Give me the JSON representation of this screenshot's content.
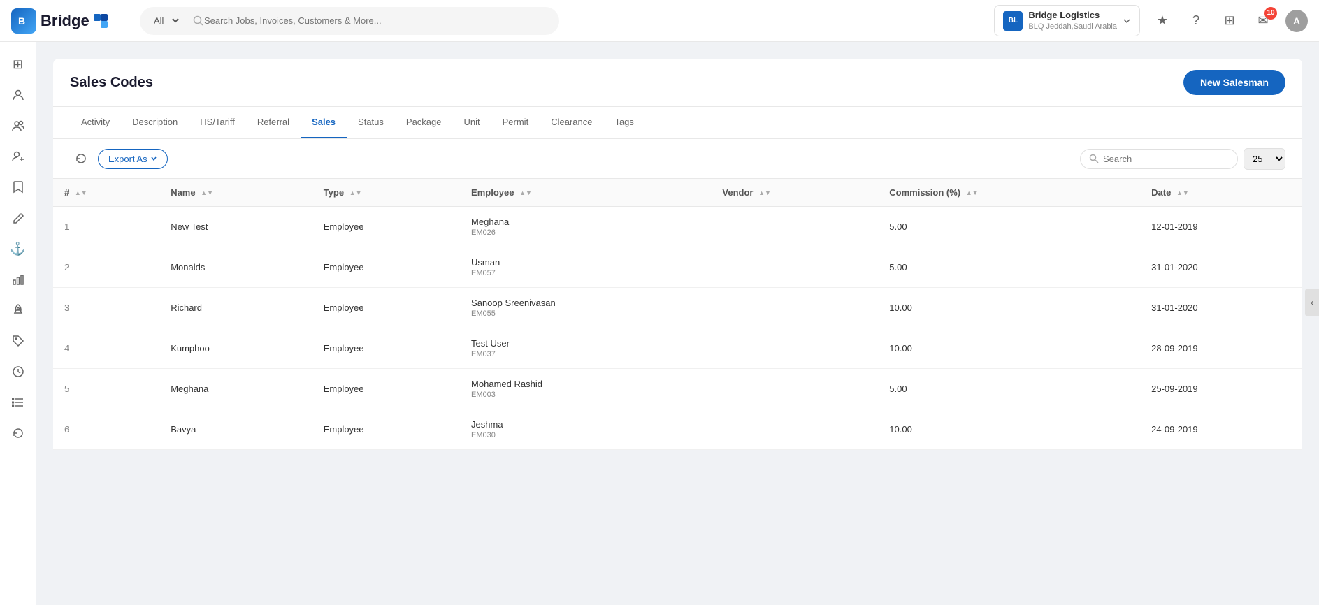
{
  "brand": {
    "name": "Bridge",
    "icon_text": "B"
  },
  "navbar": {
    "search_placeholder": "Search Jobs, Invoices, Customers & More...",
    "search_filter": "All",
    "company": {
      "name": "Bridge Logistics",
      "sub": "BLQ Jeddah,Saudi Arabia",
      "logo_text": "BL"
    },
    "notification_count": "10",
    "avatar_text": "A"
  },
  "sidebar": {
    "items": [
      {
        "icon": "⊞",
        "name": "grid-icon"
      },
      {
        "icon": "👤",
        "name": "person-icon"
      },
      {
        "icon": "👥",
        "name": "people-icon"
      },
      {
        "icon": "➕",
        "name": "add-person-icon"
      },
      {
        "icon": "🔖",
        "name": "bookmark-icon"
      },
      {
        "icon": "✏️",
        "name": "edit-icon"
      },
      {
        "icon": "⚓",
        "name": "anchor-icon"
      },
      {
        "icon": "📊",
        "name": "chart-icon"
      },
      {
        "icon": "🚀",
        "name": "rocket-icon"
      },
      {
        "icon": "🏷️",
        "name": "tag-icon"
      },
      {
        "icon": "🕐",
        "name": "clock-icon"
      },
      {
        "icon": "📋",
        "name": "list-icon"
      },
      {
        "icon": "🔄",
        "name": "refresh-icon"
      }
    ]
  },
  "page": {
    "title": "Sales Codes",
    "new_button_label": "New Salesman"
  },
  "tabs": [
    {
      "label": "Activity",
      "active": false
    },
    {
      "label": "Description",
      "active": false
    },
    {
      "label": "HS/Tariff",
      "active": false
    },
    {
      "label": "Referral",
      "active": false
    },
    {
      "label": "Sales",
      "active": true
    },
    {
      "label": "Status",
      "active": false
    },
    {
      "label": "Package",
      "active": false
    },
    {
      "label": "Unit",
      "active": false
    },
    {
      "label": "Permit",
      "active": false
    },
    {
      "label": "Clearance",
      "active": false
    },
    {
      "label": "Tags",
      "active": false
    }
  ],
  "toolbar": {
    "export_label": "Export As",
    "search_placeholder": "Search",
    "page_size": "25"
  },
  "table": {
    "columns": [
      {
        "label": "#",
        "key": "num"
      },
      {
        "label": "Name",
        "key": "name"
      },
      {
        "label": "Type",
        "key": "type"
      },
      {
        "label": "Employee",
        "key": "employee"
      },
      {
        "label": "Vendor",
        "key": "vendor"
      },
      {
        "label": "Commission (%)",
        "key": "commission"
      },
      {
        "label": "Date",
        "key": "date"
      }
    ],
    "rows": [
      {
        "num": "1",
        "name": "New Test",
        "type": "Employee",
        "employee_name": "Meghana",
        "employee_code": "EM026",
        "vendor": "",
        "commission": "5.00",
        "date": "12-01-2019"
      },
      {
        "num": "2",
        "name": "Monalds",
        "type": "Employee",
        "employee_name": "Usman",
        "employee_code": "EM057",
        "vendor": "",
        "commission": "5.00",
        "date": "31-01-2020"
      },
      {
        "num": "3",
        "name": "Richard",
        "type": "Employee",
        "employee_name": "Sanoop Sreenivasan",
        "employee_code": "EM055",
        "vendor": "",
        "commission": "10.00",
        "date": "31-01-2020"
      },
      {
        "num": "4",
        "name": "Kumphoo",
        "type": "Employee",
        "employee_name": "Test User",
        "employee_code": "EM037",
        "vendor": "",
        "commission": "10.00",
        "date": "28-09-2019"
      },
      {
        "num": "5",
        "name": "Meghana",
        "type": "Employee",
        "employee_name": "Mohamed Rashid",
        "employee_code": "EM003",
        "vendor": "",
        "commission": "5.00",
        "date": "25-09-2019"
      },
      {
        "num": "6",
        "name": "Bavya",
        "type": "Employee",
        "employee_name": "Jeshma",
        "employee_code": "EM030",
        "vendor": "",
        "commission": "10.00",
        "date": "24-09-2019"
      }
    ]
  }
}
